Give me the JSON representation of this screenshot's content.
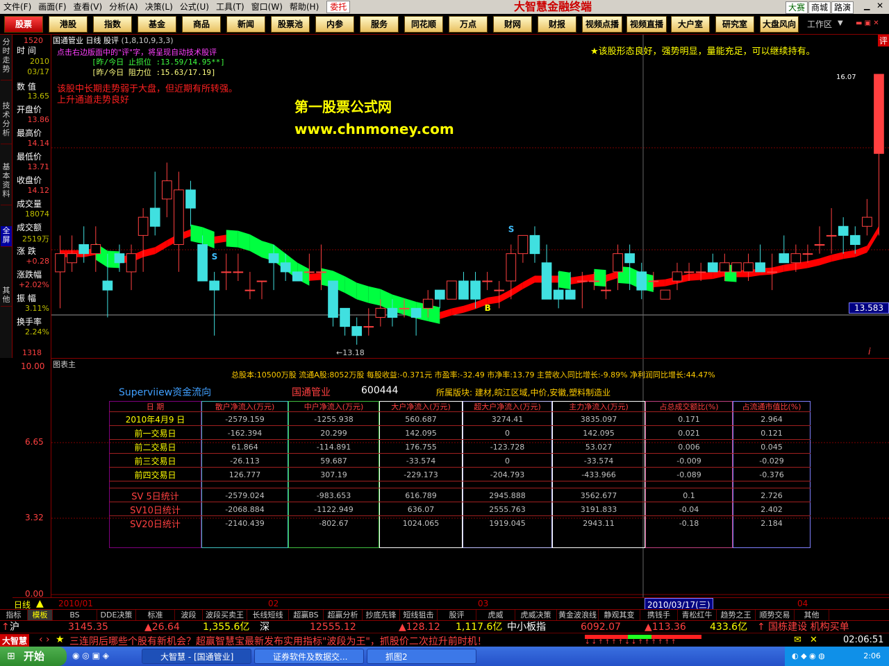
{
  "menu": {
    "items": [
      "文件(F)",
      "画面(F)",
      "查看(V)",
      "分析(A)",
      "决策(L)",
      "公式(U)",
      "工具(T)",
      "窗口(W)",
      "帮助(H)"
    ],
    "entrust": "委托",
    "brand": "大智慧金融终端",
    "right_buttons": [
      "大赛",
      "商城",
      "路演"
    ]
  },
  "nav": {
    "items": [
      "股票",
      "港股",
      "指数",
      "基金",
      "商品",
      "新闻",
      "股票池",
      "内参",
      "服务",
      "同花顺",
      "万点",
      "财网",
      "财报",
      "视频点播",
      "视频直播",
      "大户室",
      "研究室",
      "大盘风向"
    ],
    "active_index": 0,
    "workspace": "工作区"
  },
  "left_tabs": [
    "分时走势",
    "技术分析",
    "基本资料",
    "全屏",
    "其他"
  ],
  "info": {
    "time_label": "时 间",
    "year": "2010",
    "date": "03/17",
    "value_label": "数 值",
    "value": "13.65",
    "open_label": "开盘价",
    "open": "13.86",
    "high_label": "最高价",
    "high": "14.14",
    "low_label": "最低价",
    "low": "13.71",
    "close_label": "收盘价",
    "close": "14.12",
    "volume_label": "成交量",
    "volume": "18074",
    "amount_label": "成交额",
    "amount": "2519万",
    "change_label": "涨 跌",
    "change": "+0.28",
    "change_pct_label": "涨跌幅",
    "change_pct": "+2.02%",
    "amplitude_label": "振 幅",
    "amplitude": "3.11%",
    "turnover_label": "换手率",
    "turnover": "2.24%"
  },
  "chart_header": {
    "stock_name": "国通管业",
    "period": "日线",
    "indicator": "股评",
    "params": "(1,8,10,9,3,3)",
    "top_value": "1520",
    "hint": "点击右边版面中的\"评\"字，将呈现自动技术股评",
    "stop_loss": "[昨/今日 止损位 :13.59/14.95**]",
    "resistance": "[昨/今日 阻力位 :15.63/17.19]",
    "comment_left_1": "该股中长期走势弱于大盘，但近期有所转强。",
    "comment_left_2": "上升通道走势良好",
    "comment_right": "★该股形态良好，强势明显，量能充足，可以继续持有。",
    "watermark_1": "第一股票公式网",
    "watermark_2": "www.chnmoney.com",
    "max_label": "16.07",
    "min_label": "←13.18",
    "low_axis_label": "1318",
    "current_price": "13.583"
  },
  "chart_data": {
    "type": "candlestick",
    "ohlc": [
      [
        13.9,
        14.3,
        13.5,
        14.1
      ],
      [
        14.0,
        14.3,
        13.9,
        14.1
      ],
      [
        14.2,
        14.4,
        14.0,
        14.1
      ],
      [
        14.1,
        14.4,
        13.9,
        14.2
      ],
      [
        13.8,
        14.1,
        13.4,
        13.7
      ],
      [
        14.1,
        14.2,
        13.9,
        14.0
      ],
      [
        13.9,
        14.2,
        13.7,
        14.1
      ],
      [
        14.3,
        14.6,
        13.9,
        14.5
      ],
      [
        14.6,
        15.0,
        14.3,
        14.4
      ],
      [
        14.7,
        15.1,
        14.5,
        14.9
      ],
      [
        14.2,
        15.0,
        13.9,
        14.8
      ],
      [
        14.8,
        14.9,
        14.4,
        14.6
      ],
      [
        14.2,
        14.3,
        13.8,
        13.8
      ],
      [
        13.8,
        13.9,
        13.2,
        13.7
      ],
      [
        13.9,
        14.1,
        13.7,
        13.9
      ],
      [
        13.9,
        14.1,
        13.8,
        13.9
      ],
      [
        13.7,
        13.9,
        13.6,
        13.7
      ],
      [
        13.8,
        13.8,
        13.6,
        13.8
      ],
      [
        14.1,
        14.2,
        13.7,
        14.0
      ],
      [
        14.0,
        14.1,
        13.8,
        13.9
      ],
      [
        13.9,
        13.9,
        13.8,
        13.8
      ],
      [
        13.9,
        14.1,
        13.8,
        13.9
      ],
      [
        13.9,
        14.2,
        13.7,
        13.9
      ],
      [
        13.8,
        13.8,
        13.3,
        13.4
      ],
      [
        13.5,
        13.5,
        13.2,
        13.3
      ],
      [
        13.3,
        13.4,
        13.1,
        13.2
      ],
      [
        13.3,
        13.5,
        13.2,
        13.3
      ],
      [
        13.4,
        13.6,
        13.3,
        13.5
      ],
      [
        13.5,
        13.6,
        13.3,
        13.4
      ],
      [
        13.5,
        13.6,
        13.4,
        13.5
      ],
      [
        13.5,
        13.5,
        13.2,
        13.4
      ],
      [
        13.5,
        13.7,
        13.4,
        13.6
      ],
      [
        13.7,
        13.7,
        13.5,
        13.6
      ],
      [
        13.6,
        13.8,
        13.6,
        13.8
      ],
      [
        13.8,
        13.9,
        13.6,
        13.6
      ],
      [
        13.8,
        13.9,
        13.5,
        13.6
      ],
      [
        13.8,
        13.9,
        13.7,
        13.8
      ],
      [
        13.7,
        13.8,
        13.5,
        13.7
      ],
      [
        13.8,
        14.2,
        13.6,
        14.1
      ],
      [
        14.1,
        14.3,
        14.0,
        14.3
      ],
      [
        14.3,
        14.4,
        14.0,
        14.1
      ],
      [
        14.0,
        14.2,
        13.6,
        13.6
      ],
      [
        13.7,
        13.9,
        13.5,
        13.6
      ],
      [
        13.7,
        13.9,
        13.6,
        13.6
      ],
      [
        13.8,
        13.9,
        13.5,
        13.8
      ],
      [
        13.8,
        13.9,
        13.7,
        13.8
      ],
      [
        13.7,
        13.8,
        13.6,
        13.7
      ],
      [
        13.9,
        14.2,
        13.7,
        14.1
      ],
      [
        14.1,
        14.2,
        13.7,
        14.0
      ],
      [
        13.9,
        14.0,
        13.6,
        13.7
      ],
      [
        13.8,
        13.9,
        13.7,
        13.8
      ],
      [
        13.6,
        13.7,
        13.6,
        13.7
      ],
      [
        13.8,
        14.0,
        13.7,
        13.9
      ],
      [
        13.9,
        14.0,
        13.8,
        13.9
      ],
      [
        13.9,
        14.0,
        13.8,
        13.9
      ],
      [
        14.0,
        14.1,
        13.9,
        13.9
      ],
      [
        13.9,
        14.1,
        13.8,
        14.0
      ],
      [
        13.9,
        14.0,
        13.9,
        14.0
      ],
      [
        13.9,
        14.1,
        13.8,
        14.0
      ],
      [
        14.0,
        14.2,
        13.9,
        13.9
      ],
      [
        13.9,
        14.1,
        13.7,
        13.9
      ],
      [
        14.1,
        14.3,
        14.0,
        14.0
      ],
      [
        14.0,
        14.2,
        13.9,
        14.1
      ],
      [
        14.1,
        14.2,
        14.0,
        14.1
      ],
      [
        14.2,
        14.4,
        14.1,
        14.2
      ],
      [
        14.3,
        14.6,
        14.1,
        14.3
      ],
      [
        14.4,
        14.5,
        14.1,
        14.3
      ],
      [
        14.3,
        14.4,
        14.1,
        14.2
      ],
      [
        14.4,
        14.7,
        14.3,
        14.5
      ],
      [
        15.2,
        16.07,
        14.3,
        16.07
      ]
    ],
    "signals": [
      {
        "label": "S",
        "index": 13
      },
      {
        "label": "B",
        "index": 36
      },
      {
        "label": "S",
        "index": 38
      }
    ]
  },
  "sub": {
    "title": "图表主",
    "axis": [
      "10.00",
      "6.65",
      "3.32",
      "0.00"
    ],
    "fundamentals": "总股本:10500万股 流通A股:8052万股 每股收益:-0.371元 市盈率:-32.49 市净率:13.79 主营收入同比增长:-9.89% 净利润同比增长:44.47%",
    "flow_title": "Superviiew资金流向",
    "stock_name": "国通管业",
    "stock_code": "600444",
    "sector": "所属版块: 建材,皖江区域,中价,安徽,塑料制造业",
    "columns": [
      "日    期",
      "散户净流入(万元)",
      "中户净流入(万元)",
      "大户净流入(万元)",
      "超大户净流入(万元)",
      "主力净流入(万元)",
      "占总成交额比(%)",
      "占流通市值比(%)"
    ],
    "rows": [
      [
        "2010年4月9 日",
        "-2579.159",
        "-1255.938",
        "560.687",
        "3274.41",
        "3835.097",
        "0.171",
        "2.964"
      ],
      [
        "前一交易日",
        "-162.394",
        "20.299",
        "142.095",
        "0",
        "142.095",
        "0.021",
        "0.121"
      ],
      [
        "前二交易日",
        "61.864",
        "-114.891",
        "176.755",
        "-123.728",
        "53.027",
        "0.006",
        "0.045"
      ],
      [
        "前三交易日",
        "-26.113",
        "59.687",
        "-33.574",
        "0",
        "-33.574",
        "-0.009",
        "-0.029"
      ],
      [
        "前四交易日",
        "126.777",
        "307.19",
        "-229.173",
        "-204.793",
        "-433.966",
        "-0.089",
        "-0.376"
      ]
    ],
    "stat_rows": [
      [
        "SV 5日统计",
        "-2579.024",
        "-983.653",
        "616.789",
        "2945.888",
        "3562.677",
        "0.1",
        "2.726"
      ],
      [
        "SV10日统计",
        "-2068.884",
        "-1122.949",
        "636.07",
        "2555.763",
        "3191.833",
        "-0.04",
        "2.402"
      ],
      [
        "SV20日统计",
        "-2140.439",
        "-802.67",
        "1024.065",
        "1919.045",
        "2943.11",
        "-0.18",
        "2.184"
      ]
    ]
  },
  "timeline": {
    "period": "日线",
    "labels": [
      "2010/01",
      "02",
      "03",
      "04"
    ],
    "cursor_date": "2010/03/17(三)"
  },
  "tabs": [
    "指标",
    "模板",
    "BS",
    "DDE决策",
    "标准",
    "波段",
    "波段买卖王",
    "长线短线",
    "超赢BS",
    "超赢分析",
    "抄底先锋",
    "短线狙击",
    "股评",
    "虎威",
    "虎威决策",
    "黄金波浪线",
    "静观其变",
    "携钱手",
    "青松红牛",
    "趋势之王",
    "顺势交易",
    "其他"
  ],
  "active_tab": 1,
  "quotes": {
    "sh_label": "沪",
    "sh_index": "3145.35",
    "sh_change": "▲26.64",
    "sh_amount": "1,355.6亿",
    "sz_label": "深",
    "sz_index": "12555.12",
    "sz_change": "▲128.12",
    "sz_amount": "1,117.6亿",
    "sme_label": "中小板指",
    "sme_index": "6092.07",
    "sme_change": "▲113.36",
    "sme_amount": "433.6亿",
    "news": "↑ 国栋建设 机构买单"
  },
  "ticker": {
    "logo": "大智慧",
    "message": "三连阴后哪些个股有新机会？超赢智慧宝最新发布实用指标\"波段为王\"，抓股价二次拉升前时机！",
    "time": "02:06:51"
  },
  "taskbar": {
    "start": "开始",
    "tasks": [
      "大智慧 - [国通管业]",
      "证券软件及数据交...",
      "抓图2"
    ],
    "clock": "2:06"
  },
  "colors": {
    "up": "#ff4040",
    "down": "#40e0e0",
    "band_up": "#ff0000",
    "band_down": "#00ff40"
  }
}
